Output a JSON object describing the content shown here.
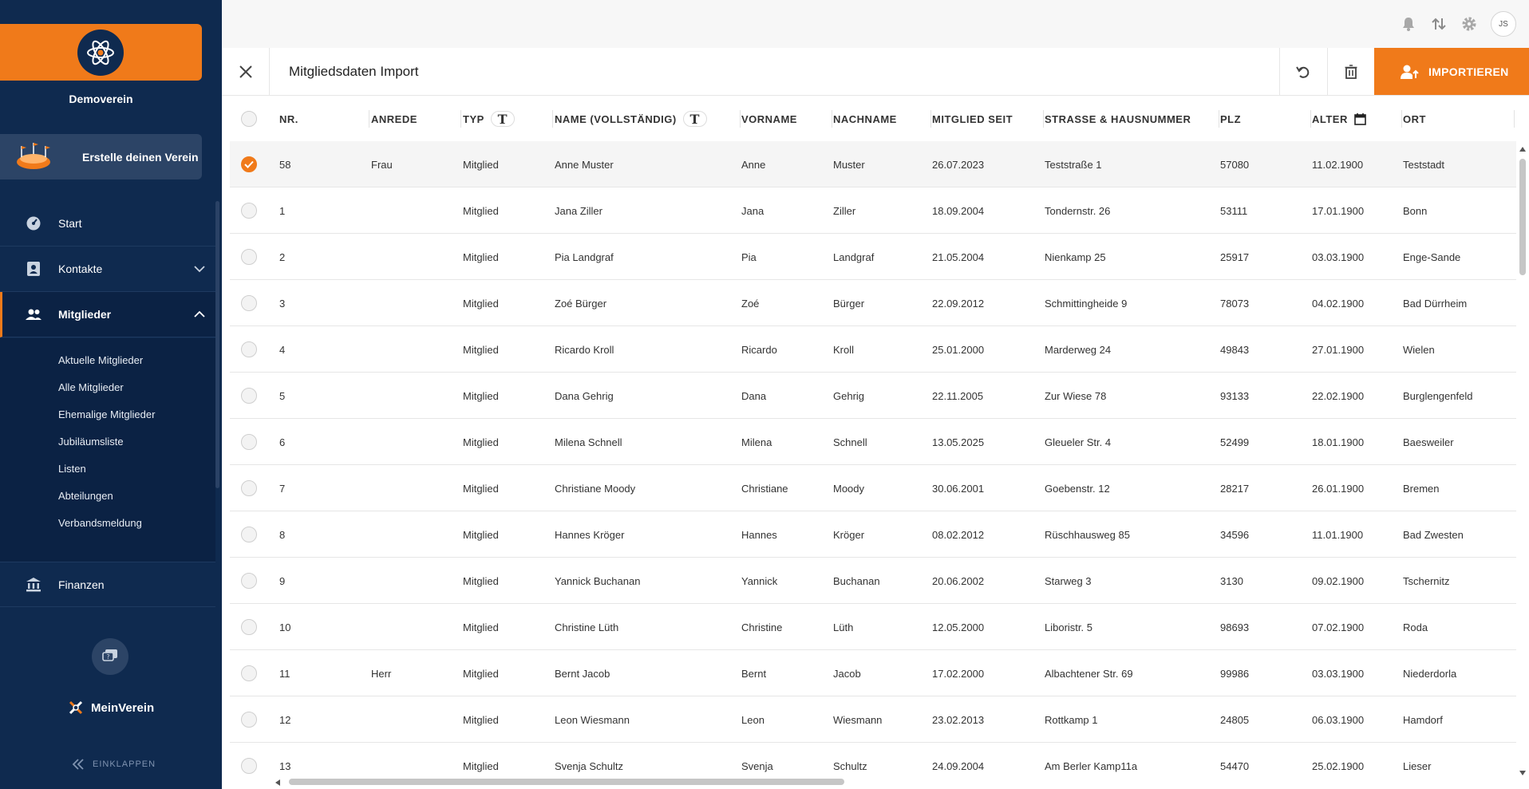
{
  "sidebar": {
    "club_name": "Demoverein",
    "create_club": "Erstelle deinen Verein",
    "nav": [
      {
        "label": "Start",
        "icon": "dashboard-icon"
      },
      {
        "label": "Kontakte",
        "icon": "contact-card-icon"
      },
      {
        "label": "Mitglieder",
        "icon": "members-icon"
      },
      {
        "label": "Finanzen",
        "icon": "bank-icon"
      }
    ],
    "sub": [
      "Aktuelle Mitglieder",
      "Alle Mitglieder",
      "Ehemalige Mitglieder",
      "Jubiläumsliste",
      "Listen",
      "Abteilungen",
      "Verbandsmeldung"
    ],
    "brand": "MeinVerein",
    "collapse": "EINKLAPPEN"
  },
  "topbar": {
    "avatar": "JS"
  },
  "header": {
    "title": "Mitgliedsdaten Import",
    "import": "IMPORTIEREN"
  },
  "colors": {
    "accent": "#f07a1a",
    "sidebar": "#0f2a4f"
  },
  "table": {
    "columns": [
      "NR.",
      "ANREDE",
      "TYP",
      "NAME (VOLLSTÄNDIG)",
      "VORNAME",
      "NACHNAME",
      "MITGLIED SEIT",
      "STRASSE & HAUSNUMMER",
      "PLZ",
      "ALTER",
      "ORT",
      "T"
    ],
    "type_marker": "T",
    "rows": [
      {
        "nr": "58",
        "anrede": "Frau",
        "typ": "Mitglied",
        "name": "Anne Muster",
        "vorname": "Anne",
        "nachname": "Muster",
        "seit": "26.07.2023",
        "strasse": "Teststraße 1",
        "plz": "57080",
        "alter": "11.02.1900",
        "ort": "Teststadt"
      },
      {
        "nr": "1",
        "anrede": "",
        "typ": "Mitglied",
        "name": "Jana Ziller",
        "vorname": "Jana",
        "nachname": "Ziller",
        "seit": "18.09.2004",
        "strasse": "Tondernstr. 26",
        "plz": "53111",
        "alter": "17.01.1900",
        "ort": "Bonn"
      },
      {
        "nr": "2",
        "anrede": "",
        "typ": "Mitglied",
        "name": "Pia Landgraf",
        "vorname": "Pia",
        "nachname": "Landgraf",
        "seit": "21.05.2004",
        "strasse": "Nienkamp 25",
        "plz": "25917",
        "alter": "03.03.1900",
        "ort": "Enge-Sande"
      },
      {
        "nr": "3",
        "anrede": "",
        "typ": "Mitglied",
        "name": "Zoé Bürger",
        "vorname": "Zoé",
        "nachname": "Bürger",
        "seit": "22.09.2012",
        "strasse": "Schmittingheide 9",
        "plz": "78073",
        "alter": "04.02.1900",
        "ort": "Bad Dürrheim"
      },
      {
        "nr": "4",
        "anrede": "",
        "typ": "Mitglied",
        "name": "Ricardo Kroll",
        "vorname": "Ricardo",
        "nachname": "Kroll",
        "seit": "25.01.2000",
        "strasse": "Marderweg 24",
        "plz": "49843",
        "alter": "27.01.1900",
        "ort": "Wielen"
      },
      {
        "nr": "5",
        "anrede": "",
        "typ": "Mitglied",
        "name": "Dana Gehrig",
        "vorname": "Dana",
        "nachname": "Gehrig",
        "seit": "22.11.2005",
        "strasse": "Zur Wiese 78",
        "plz": "93133",
        "alter": "22.02.1900",
        "ort": "Burglengenfeld"
      },
      {
        "nr": "6",
        "anrede": "",
        "typ": "Mitglied",
        "name": "Milena Schnell",
        "vorname": "Milena",
        "nachname": "Schnell",
        "seit": "13.05.2025",
        "strasse": "Gleueler Str. 4",
        "plz": "52499",
        "alter": "18.01.1900",
        "ort": "Baesweiler"
      },
      {
        "nr": "7",
        "anrede": "",
        "typ": "Mitglied",
        "name": "Christiane Moody",
        "vorname": "Christiane",
        "nachname": "Moody",
        "seit": "30.06.2001",
        "strasse": "Goebenstr. 12",
        "plz": "28217",
        "alter": "26.01.1900",
        "ort": "Bremen"
      },
      {
        "nr": "8",
        "anrede": "",
        "typ": "Mitglied",
        "name": "Hannes Kröger",
        "vorname": "Hannes",
        "nachname": "Kröger",
        "seit": "08.02.2012",
        "strasse": "Rüschhausweg 85",
        "plz": "34596",
        "alter": "11.01.1900",
        "ort": "Bad Zwesten"
      },
      {
        "nr": "9",
        "anrede": "",
        "typ": "Mitglied",
        "name": "Yannick Buchanan",
        "vorname": "Yannick",
        "nachname": "Buchanan",
        "seit": "20.06.2002",
        "strasse": "Starweg 3",
        "plz": "3130",
        "alter": "09.02.1900",
        "ort": "Tschernitz"
      },
      {
        "nr": "10",
        "anrede": "",
        "typ": "Mitglied",
        "name": "Christine Lüth",
        "vorname": "Christine",
        "nachname": "Lüth",
        "seit": "12.05.2000",
        "strasse": "Liboristr. 5",
        "plz": "98693",
        "alter": "07.02.1900",
        "ort": "Roda"
      },
      {
        "nr": "11",
        "anrede": "Herr",
        "typ": "Mitglied",
        "name": "Bernt Jacob",
        "vorname": "Bernt",
        "nachname": "Jacob",
        "seit": "17.02.2000",
        "strasse": "Albachtener Str. 69",
        "plz": "99986",
        "alter": "03.03.1900",
        "ort": "Niederdorla"
      },
      {
        "nr": "12",
        "anrede": "",
        "typ": "Mitglied",
        "name": "Leon Wiesmann",
        "vorname": "Leon",
        "nachname": "Wiesmann",
        "seit": "23.02.2013",
        "strasse": "Rottkamp 1",
        "plz": "24805",
        "alter": "06.03.1900",
        "ort": "Hamdorf"
      },
      {
        "nr": "13",
        "anrede": "",
        "typ": "Mitglied",
        "name": "Svenja Schultz",
        "vorname": "Svenja",
        "nachname": "Schultz",
        "seit": "24.09.2004",
        "strasse": "Am Berler Kamp11a",
        "plz": "54470",
        "alter": "25.02.1900",
        "ort": "Lieser"
      }
    ]
  }
}
